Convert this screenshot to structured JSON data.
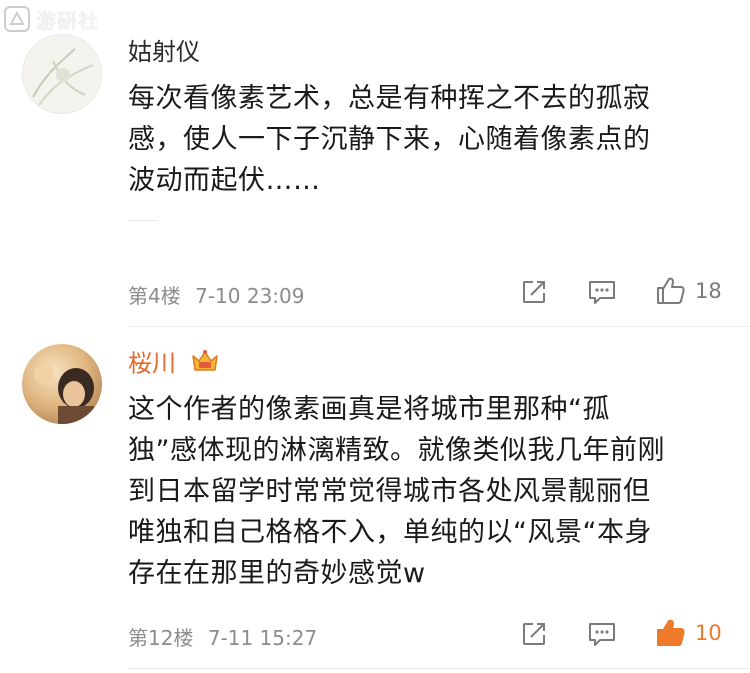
{
  "watermark": {
    "text": "游研社"
  },
  "colors": {
    "username_orange": "#e36a2c",
    "liked_orange": "#f07a2c",
    "meta_gray": "#8c8c8c"
  },
  "comments": [
    {
      "username": "姑射仪",
      "lines": [
        "每次看像素艺术，总是有种挥之不去的孤寂",
        "感，使人一下子沉静下来，心随着像素点的",
        "波动而起伏……"
      ],
      "floor": "第4楼",
      "time": "7-10 23:09",
      "likes": "18",
      "liked": false,
      "icons": [
        "forward-icon",
        "reply-icon",
        "thumbs-up-icon"
      ]
    },
    {
      "username": "桜川",
      "badge": "crown-vip-icon",
      "lines": [
        "这个作者的像素画真是将城市里那种“孤",
        "独”感体现的淋漓精致。就像类似我几年前刚",
        "到日本留学时常常觉得城市各处风景靓丽但",
        "唯独和自己格格不入，单纯的以“风景“本身",
        "存在在那里的奇妙感觉w"
      ],
      "floor": "第12楼",
      "time": "7-11 15:27",
      "likes": "10",
      "liked": true,
      "icons": [
        "forward-icon",
        "reply-icon",
        "thumbs-up-icon"
      ]
    }
  ]
}
